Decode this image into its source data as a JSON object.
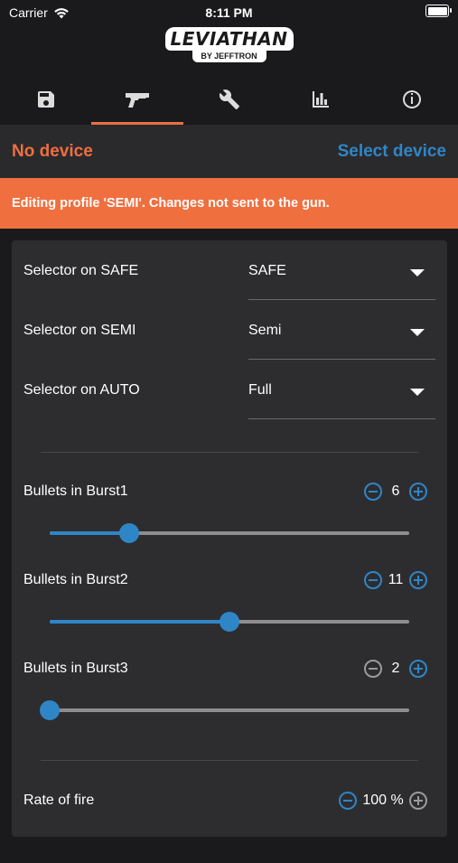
{
  "status": {
    "carrier": "Carrier",
    "time": "8:11 PM"
  },
  "logo": {
    "main": "LEVIATHAN",
    "sub": "BY JEFFTRON"
  },
  "tabs": [
    {
      "icon": "save-icon",
      "active": false
    },
    {
      "icon": "gun-icon",
      "active": true
    },
    {
      "icon": "wrench-icon",
      "active": false
    },
    {
      "icon": "bar-chart-icon",
      "active": false
    },
    {
      "icon": "info-icon",
      "active": false
    }
  ],
  "device": {
    "status": "No device",
    "action": "Select device"
  },
  "banner": {
    "text": "Editing profile 'SEMI'. Changes not sent to the gun."
  },
  "selectors": [
    {
      "label": "Selector on SAFE",
      "value": "SAFE"
    },
    {
      "label": "Selector on SEMI",
      "value": "Semi"
    },
    {
      "label": "Selector on AUTO",
      "value": "Full"
    }
  ],
  "bursts": [
    {
      "label": "Bullets in Burst1",
      "value": "6",
      "fraction": 0.22,
      "minus_enabled": true
    },
    {
      "label": "Bullets in Burst2",
      "value": "11",
      "fraction": 0.5,
      "minus_enabled": true
    },
    {
      "label": "Bullets in Burst3",
      "value": "2",
      "fraction": 0.0,
      "minus_enabled": false
    }
  ],
  "rate_of_fire": {
    "label": "Rate of fire",
    "value": "100 %"
  },
  "colors": {
    "accent": "#ef6f3f",
    "link": "#2f86c6",
    "background": "#1a1a1c",
    "card": "#2d2d30"
  }
}
